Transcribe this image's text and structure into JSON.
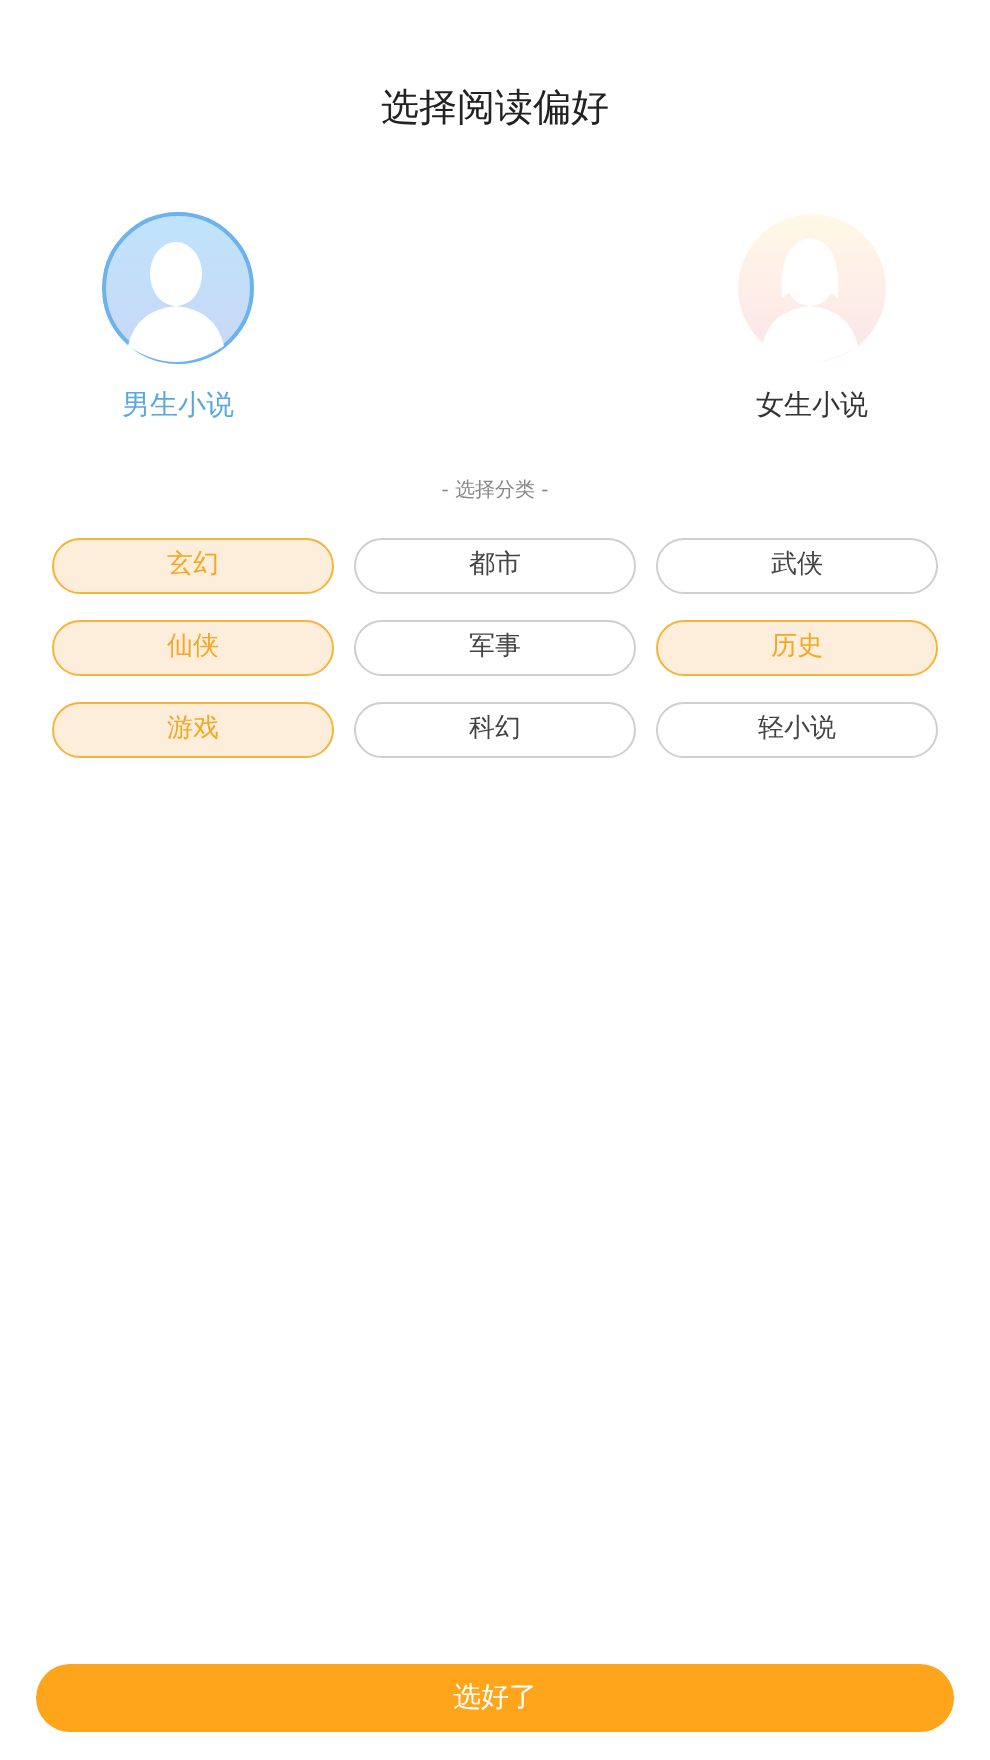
{
  "title": "选择阅读偏好",
  "genders": [
    {
      "label": "男生小说",
      "kind": "male",
      "selected": true
    },
    {
      "label": "女生小说",
      "kind": "female",
      "selected": false
    }
  ],
  "section_label": "- 选择分类 -",
  "categories": [
    {
      "label": "玄幻",
      "selected": true
    },
    {
      "label": "都市",
      "selected": false
    },
    {
      "label": "武侠",
      "selected": false
    },
    {
      "label": "仙侠",
      "selected": true
    },
    {
      "label": "军事",
      "selected": false
    },
    {
      "label": "历史",
      "selected": true
    },
    {
      "label": "游戏",
      "selected": true
    },
    {
      "label": "科幻",
      "selected": false
    },
    {
      "label": "轻小说",
      "selected": false
    }
  ],
  "confirm_button": "选好了"
}
